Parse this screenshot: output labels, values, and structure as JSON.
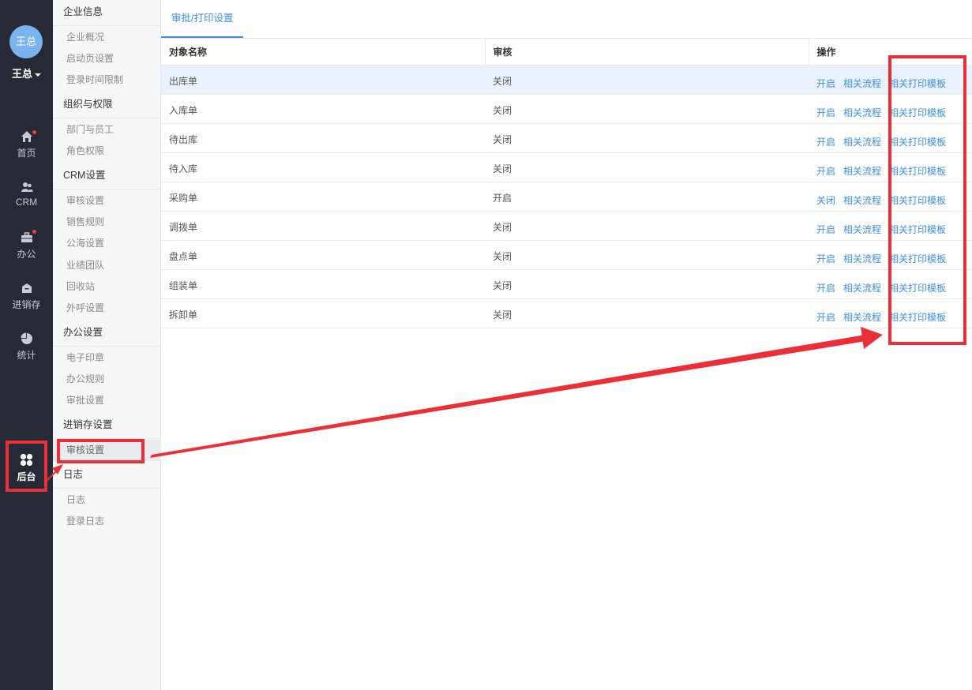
{
  "user": {
    "avatar_text": "王总",
    "name": "王总"
  },
  "rail": {
    "items": [
      {
        "key": "home",
        "label": "首页",
        "icon": "home-icon",
        "badge": true
      },
      {
        "key": "crm",
        "label": "CRM",
        "icon": "users-icon",
        "badge": false
      },
      {
        "key": "office",
        "label": "办公",
        "icon": "briefcase-icon",
        "badge": true
      },
      {
        "key": "inventory",
        "label": "进销存",
        "icon": "warehouse-icon",
        "badge": false
      },
      {
        "key": "stats",
        "label": "统计",
        "icon": "pie-chart-icon",
        "badge": false
      },
      {
        "key": "admin",
        "label": "后台",
        "icon": "grid-icon",
        "badge": false,
        "active": true
      }
    ]
  },
  "menu": {
    "groups": [
      {
        "title": "企业信息",
        "items": [
          "企业概况",
          "启动页设置",
          "登录时间限制"
        ]
      },
      {
        "title": "组织与权限",
        "items": [
          "部门与员工",
          "角色权限"
        ]
      },
      {
        "title": "CRM设置",
        "items": [
          "审核设置",
          "销售规则",
          "公海设置",
          "业绩团队",
          "回收站",
          "外呼设置"
        ]
      },
      {
        "title": "办公设置",
        "items": [
          "电子印章",
          "办公规则",
          "审批设置"
        ]
      },
      {
        "title": "进销存设置",
        "items": [
          "审核设置"
        ]
      },
      {
        "title": "日志",
        "items": [
          "日志",
          "登录日志"
        ]
      }
    ]
  },
  "main": {
    "tab": "审批/打印设置",
    "columns": [
      "对象名称",
      "审核",
      "操作"
    ],
    "rows": [
      {
        "name": "出库单",
        "status": "关闭",
        "toggle": "开启"
      },
      {
        "name": "入库单",
        "status": "关闭",
        "toggle": "开启"
      },
      {
        "name": "待出库",
        "status": "关闭",
        "toggle": "开启"
      },
      {
        "name": "待入库",
        "status": "关闭",
        "toggle": "开启"
      },
      {
        "name": "采购单",
        "status": "开启",
        "toggle": "关闭"
      },
      {
        "name": "调拨单",
        "status": "关闭",
        "toggle": "开启"
      },
      {
        "name": "盘点单",
        "status": "关闭",
        "toggle": "开启"
      },
      {
        "name": "组装单",
        "status": "关闭",
        "toggle": "开启"
      },
      {
        "name": "拆卸单",
        "status": "关闭",
        "toggle": "开启"
      }
    ],
    "op_flow": "相关流程",
    "op_print": "相关打印模板"
  },
  "colors": {
    "rail_bg": "#262a36",
    "accent": "#3a8ee6",
    "annotation": "#ec2f36"
  }
}
